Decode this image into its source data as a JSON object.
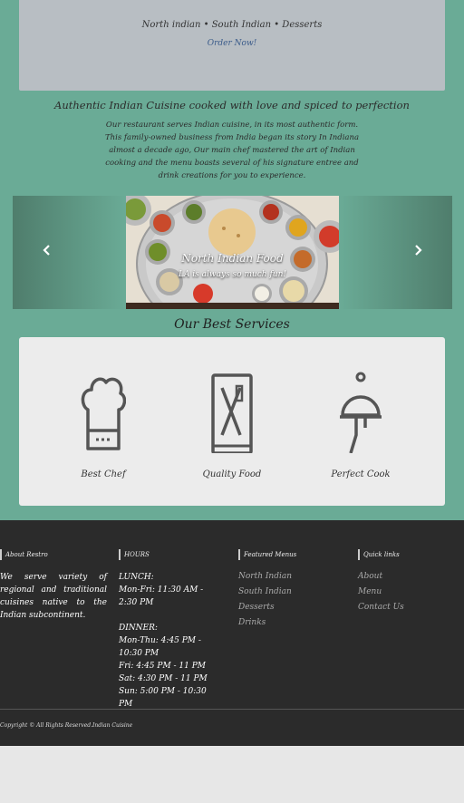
{
  "hero": {
    "menu_line": "North indian • South Indian • Desserts",
    "order_link": "Order Now!"
  },
  "intro": {
    "tagline": "Authentic Indian Cuisine cooked with love and spiced to perfection",
    "about": "Our restaurant serves Indian cuisine, in its most authentic form. This family-owned business from India began its story In Indiana almost a decade ago, Our main chef mastered the art of Indian cooking and the menu boasts several of his signature entree and drink creations for you to experience."
  },
  "carousel": {
    "slide_title": "North Indian Food",
    "slide_subtitle": "LA is always so much fun!",
    "prev_icon": "chevron-left-icon",
    "next_icon": "chevron-right-icon"
  },
  "services": {
    "title": "Our Best Services",
    "items": [
      {
        "label": "Best Chef",
        "icon": "chef-hat-icon"
      },
      {
        "label": "Quality Food",
        "icon": "menu-book-icon"
      },
      {
        "label": "Perfect Cook",
        "icon": "cloche-icon"
      }
    ]
  },
  "footer": {
    "about_heading": "About Restro",
    "about_text": "We serve variety of regional and traditional cuisines native to the Indian subcontinent.",
    "hours_heading": "HOURS",
    "hours": {
      "lunch_label": "LUNCH:",
      "lunch": "Mon-Fri: 11:30 AM - 2:30 PM",
      "dinner_label": "DINNER:",
      "dinner_mon_thu": "Mon-Thu: 4:45 PM - 10:30 PM",
      "dinner_fri": "Fri: 4:45 PM - 11 PM",
      "dinner_sat": "Sat: 4:30 PM - 11 PM",
      "dinner_sun": "Sun: 5:00 PM - 10:30 PM"
    },
    "featured_heading": "Featured Menus",
    "featured": [
      "North Indian",
      "South Indian",
      "Desserts",
      "Drinks"
    ],
    "quick_heading": "Quick links",
    "quick": [
      "About",
      "Menu",
      "Contact Us"
    ],
    "copyright": "Copyright © All Rights Reserved.Indian Cuisine"
  },
  "colors": {
    "page_bg": "#6aab96",
    "hero_bg": "#b8bec3",
    "footer_bg": "#2b2b2b",
    "link": "#3a5b8a"
  }
}
